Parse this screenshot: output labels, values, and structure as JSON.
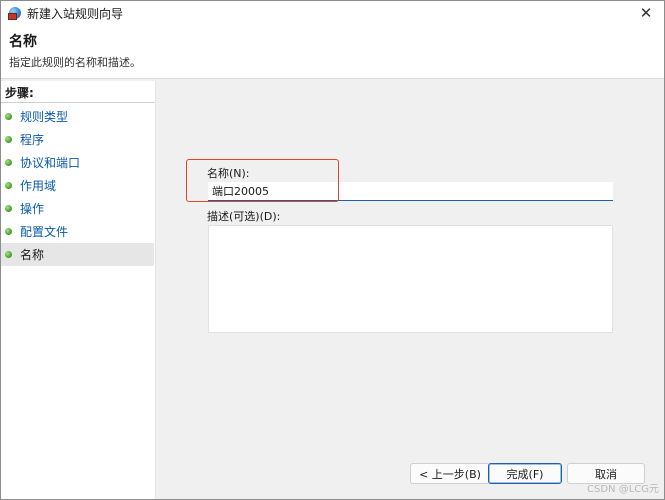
{
  "window": {
    "title": "新建入站规则向导",
    "close_glyph": "✕"
  },
  "header": {
    "title": "名称",
    "description": "指定此规则的名称和描述。"
  },
  "steps": {
    "label": "步骤:",
    "items": [
      {
        "label": "规则类型"
      },
      {
        "label": "程序"
      },
      {
        "label": "协议和端口"
      },
      {
        "label": "作用域"
      },
      {
        "label": "操作"
      },
      {
        "label": "配置文件"
      },
      {
        "label": "名称",
        "current": true
      }
    ]
  },
  "form": {
    "name_label": "名称(N):",
    "name_value": "端口20005",
    "description_label": "描述(可选)(D):",
    "description_value": ""
  },
  "buttons": {
    "back": "< 上一步(B)",
    "finish": "完成(F)",
    "cancel": "取消"
  },
  "watermark": "CSDN @LCG元",
  "colors": {
    "step_link": "#0b5aa8",
    "highlight": "#e0452a",
    "input_underline": "#1f5fa8"
  }
}
